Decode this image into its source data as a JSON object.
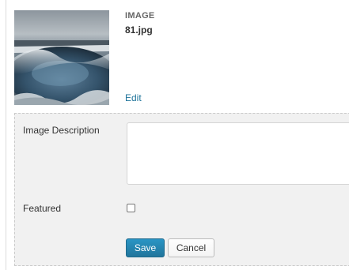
{
  "attachment": {
    "type_label": "IMAGE",
    "filename": "81.jpg",
    "edit_label": "Edit",
    "thumbnail_icon": "hot-spring-photo"
  },
  "form": {
    "description_label": "Image Description",
    "description_value": "",
    "featured_label": "Featured",
    "featured_checked": false,
    "save_label": "Save",
    "cancel_label": "Cancel"
  },
  "colors": {
    "link": "#21759b",
    "primary_button": "#21759b",
    "panel_background": "#f1f1f1"
  }
}
